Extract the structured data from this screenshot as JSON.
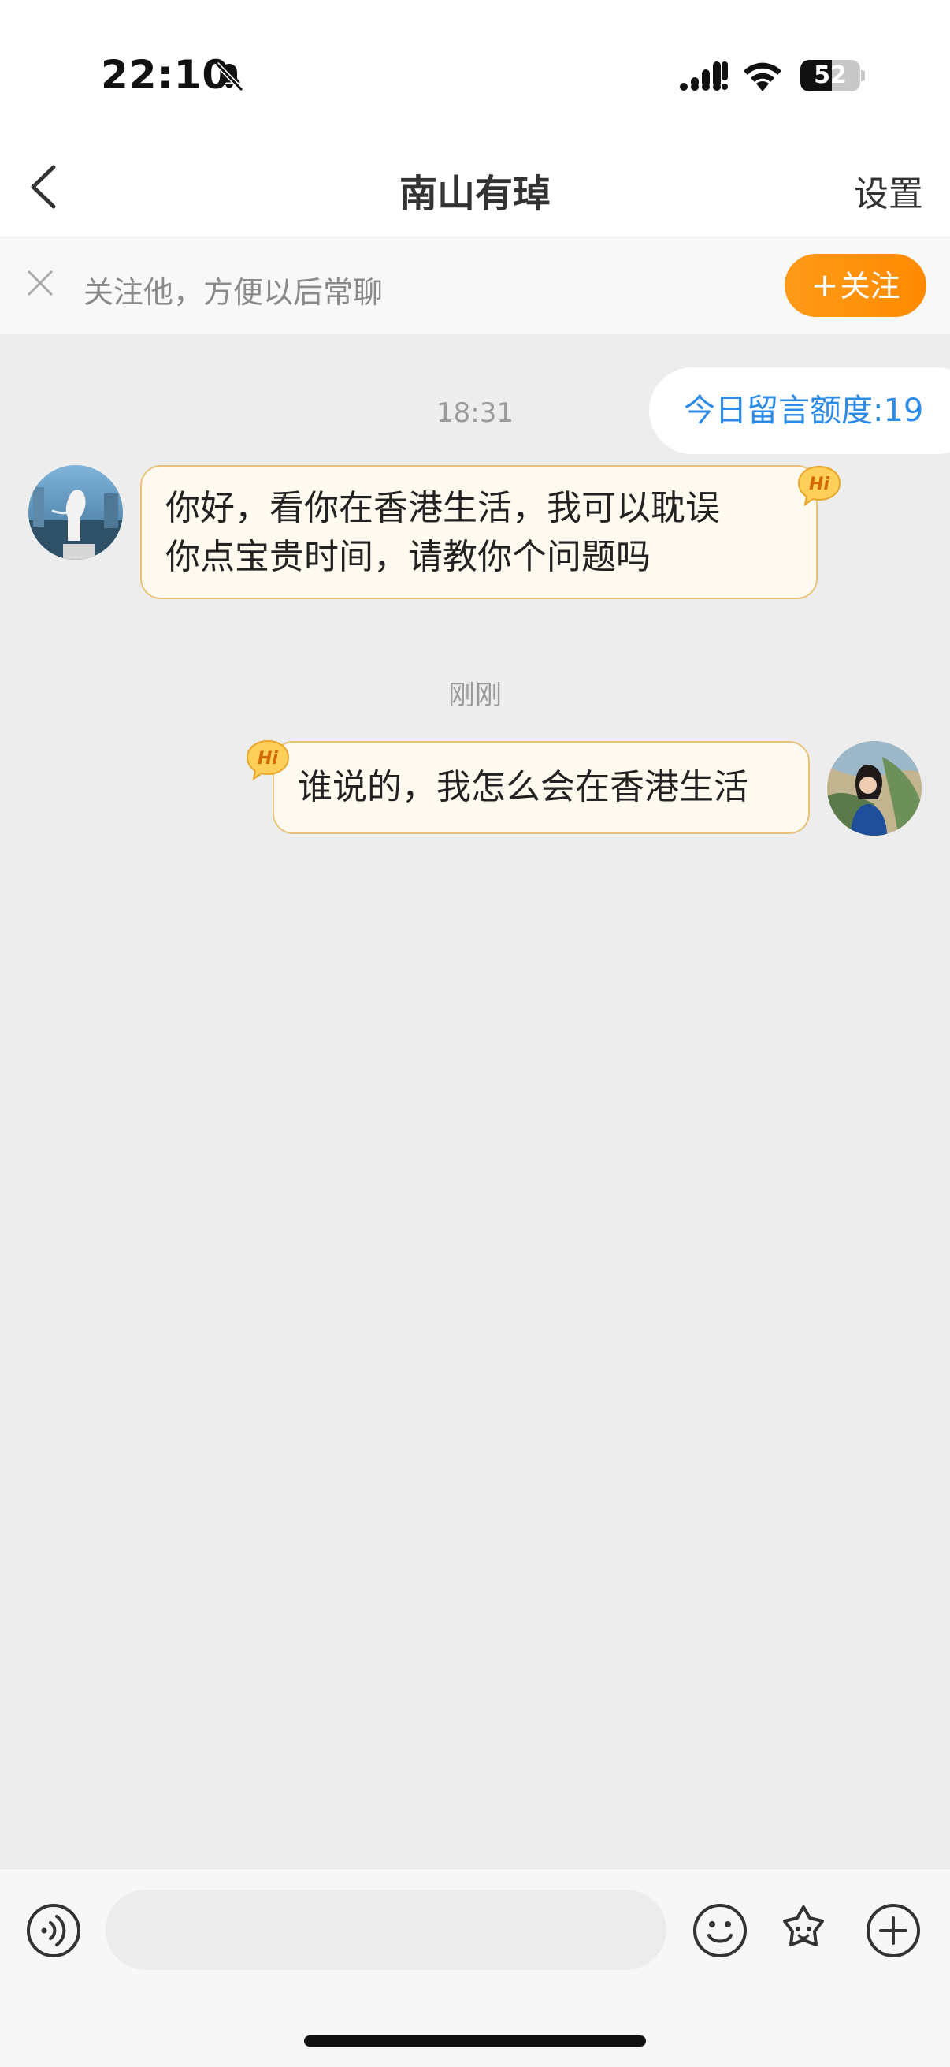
{
  "status_bar": {
    "time": "22:10",
    "battery": "52",
    "battery_level": 0.52
  },
  "nav": {
    "title": "南山有琸",
    "settings_label": "设置"
  },
  "follow_banner": {
    "text": "关注他，方便以后常聊",
    "button_plus": "+",
    "button_label": "关注"
  },
  "quota": {
    "label": "今日留言额度:19"
  },
  "messages": [
    {
      "timestamp": "18:31",
      "side": "left",
      "text_line1": "你好，看你在香港生活，我可以耽误",
      "text_line2": "你点宝贵时间，请教你个问题吗",
      "badge": "Hi"
    },
    {
      "timestamp": "刚刚",
      "side": "right",
      "text": "谁说的，我怎么会在香港生活",
      "badge": "Hi"
    }
  ],
  "input": {
    "placeholder": ""
  },
  "colors": {
    "accent": "#ff9500",
    "link_blue": "#2b8be6",
    "bubble_bg": "#fffaf0",
    "bubble_border": "#e8c27a",
    "chat_bg": "#ededed"
  },
  "icons": [
    "bell-slash-icon",
    "cellular-signal-icon",
    "wifi-icon",
    "battery-icon",
    "back-chevron-icon",
    "close-icon",
    "voice-icon",
    "emoji-icon",
    "gift-icon",
    "plus-circle-icon"
  ]
}
